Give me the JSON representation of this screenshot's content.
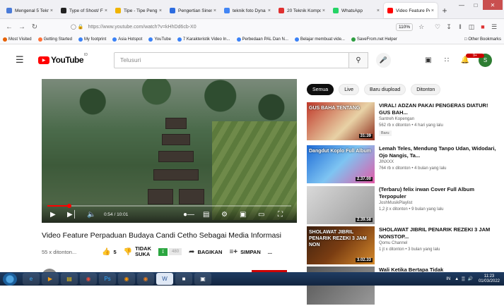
{
  "browser": {
    "tabs": [
      {
        "label": "Mengenal 5 Tekn",
        "color": "#4a7bd8"
      },
      {
        "label": "Type of Shoot/ F",
        "color": "#222222"
      },
      {
        "label": "Tipe - Tipe Peng",
        "color": "#f0b400"
      },
      {
        "label": "Pengertian Sinem",
        "color": "#2d6cdf"
      },
      {
        "label": "teknik foto Dyna",
        "color": "#4285f4"
      },
      {
        "label": "20 Teknik Kompo",
        "color": "#e03030"
      },
      {
        "label": "WhatsApp",
        "color": "#25d366"
      },
      {
        "label": "Video Feature Pe",
        "color": "#ff0000"
      }
    ],
    "tab_close": "×",
    "new_tab": "+",
    "url": "https://www.youtube.com/watch?v=kHhDd6cb-X0",
    "zoom": "110%",
    "bookmarks": [
      "Most Visited",
      "Getting Started",
      "My footprint",
      "Asia Hotspot",
      "YouTube",
      "7 Karakteristik Video In...",
      "Perbedaan PAL Dan N...",
      "Belajar membuat vide...",
      "SaveFrom.net Helper"
    ],
    "other_bookmarks": "Other Bookmarks"
  },
  "youtube": {
    "logo": "YouTube",
    "logo_sup": "ID",
    "search_placeholder": "Telusuri",
    "notification_count": "9+",
    "avatar_letter": "S"
  },
  "video": {
    "time": "0:54 / 10:01",
    "progress": 0.09,
    "title": "Video Feature Perpaduan Budaya Candi Cetho Sebagai Media Informasi",
    "views": "55 x ditonton...",
    "likes": "5",
    "dislike_label_1": "TIDAK",
    "dislike_label_2": "SUKA",
    "save_count": "480",
    "share": "BAGIKAN",
    "save": "SIMPAN",
    "more": "..."
  },
  "chips": [
    "Semua",
    "Live",
    "Baru diupload",
    "Ditonton"
  ],
  "recommendations": [
    {
      "title": "VIRAL! ADZAN PAKAI PENGERAS DIATUR! GUS BAH...",
      "channel": "Santreh Kopengan",
      "meta": "562 rb x ditonton • 4 hari yang lalu",
      "badge": "Baru",
      "duration": "31:39",
      "thumb_text": "GUS BAHA TENTANG"
    },
    {
      "title": "Lemah Teles, Mendung Tanpo Udan, Widodari, Ojo Nangis, Ta...",
      "channel": "JINXXX",
      "meta": "764 rb x ditonton • 4 bulan yang lalu",
      "badge": "",
      "duration": "2.37.00",
      "thumb_text": "Dangdut Koplo Full Album"
    },
    {
      "title": "(Terbaru) felix irwan Cover Full Album Terpopuler",
      "channel": "JoshMusikPlaylist",
      "meta": "1,2 jt x ditonton • 9 bulan yang lalu",
      "badge": "",
      "duration": "2.39.58",
      "thumb_text": ""
    },
    {
      "title": "SHOLAWAT JIBRIL PENARIK REZEKI 3 JAM NONSTOP...",
      "channel": "Qomu Channel",
      "meta": "1 jt x ditonton • 3 bulan yang lalu",
      "badge": "",
      "duration": "3.02.33",
      "thumb_text": "SHOLAWAT JIBRIL PENARIK REZEKI 3 JAM NON"
    },
    {
      "title": "Wali Ketika Bertapa Tidak",
      "channel": "",
      "meta": "",
      "badge": "",
      "duration": "",
      "thumb_text": ""
    }
  ],
  "taskbar": {
    "lang": "IN",
    "time": "11:23",
    "date": "01/03/2022"
  }
}
